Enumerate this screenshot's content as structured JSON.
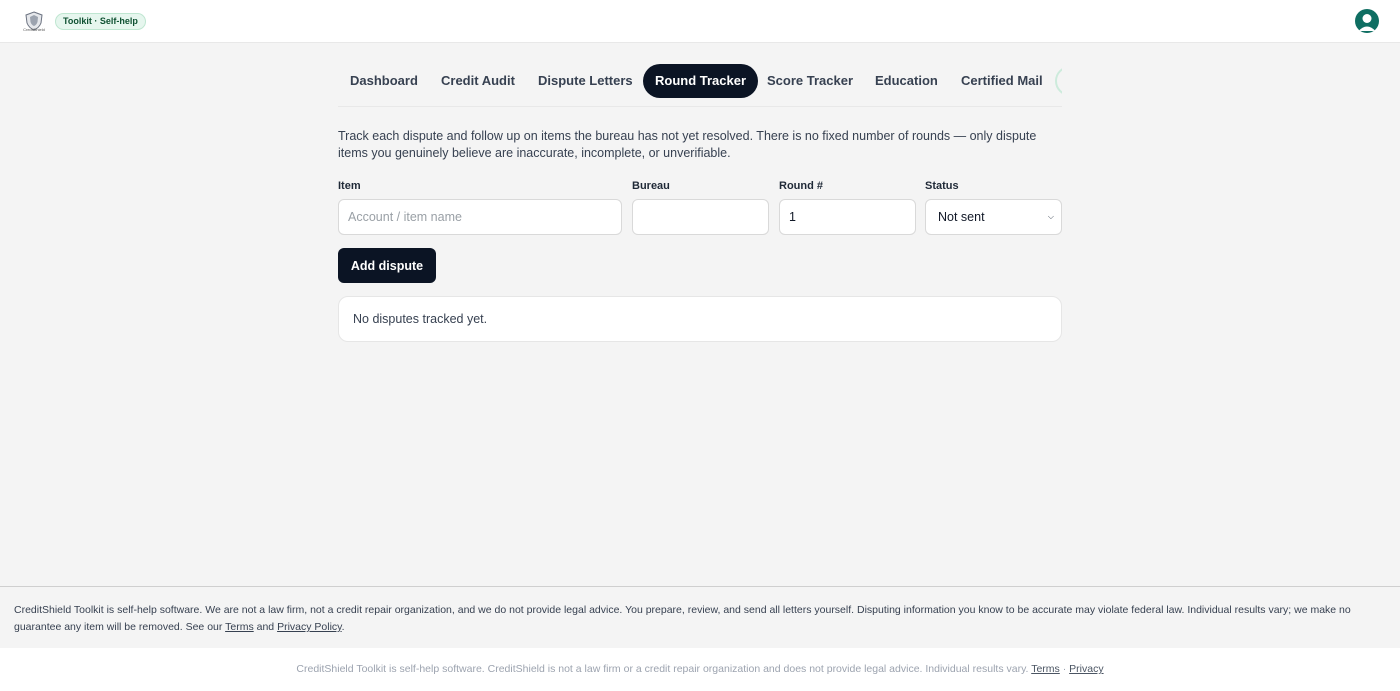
{
  "header": {
    "logo_text": "CreditShield",
    "badge": "Toolkit · Self-help"
  },
  "tabs": [
    {
      "label": "Dashboard"
    },
    {
      "label": "Credit Audit"
    },
    {
      "label": "Dispute Letters"
    },
    {
      "label": "Round Tracker",
      "active": true
    },
    {
      "label": "Score Tracker"
    },
    {
      "label": "Education"
    },
    {
      "label": "Certified Mail"
    }
  ],
  "intro": "Track each dispute and follow up on items the bureau has not yet resolved. There is no fixed number of rounds — only dispute items you genuinely believe are inaccurate, incomplete, or unverifiable.",
  "form": {
    "item_label": "Item",
    "item_placeholder": "Account / item name",
    "bureau_label": "Bureau",
    "bureau_value": "",
    "round_label": "Round #",
    "round_value": "1",
    "status_label": "Status",
    "status_value": "Not sent",
    "add_button": "Add dispute"
  },
  "empty_state": "No disputes tracked yet.",
  "footer": {
    "disclaimer_text": "CreditShield Toolkit is self-help software. We are not a law firm, not a credit repair organization, and we do not provide legal advice. You prepare, review, and send all letters yourself. Disputing information you know to be accurate may violate federal law. Individual results vary; we make no guarantee any item will be removed. See our",
    "terms": "Terms",
    "and": "and",
    "privacy_policy": "Privacy Policy",
    "period": ".",
    "bottom_text": "CreditShield Toolkit is self-help software. CreditShield is not a law firm or a credit repair organization and does not provide legal advice. Individual results vary.",
    "bottom_terms": "Terms",
    "separator": "·",
    "bottom_privacy": "Privacy"
  },
  "colors": {
    "primary": "#0b1424",
    "badge_bg": "#e6f6ee",
    "avatar": "#0f6e62"
  }
}
